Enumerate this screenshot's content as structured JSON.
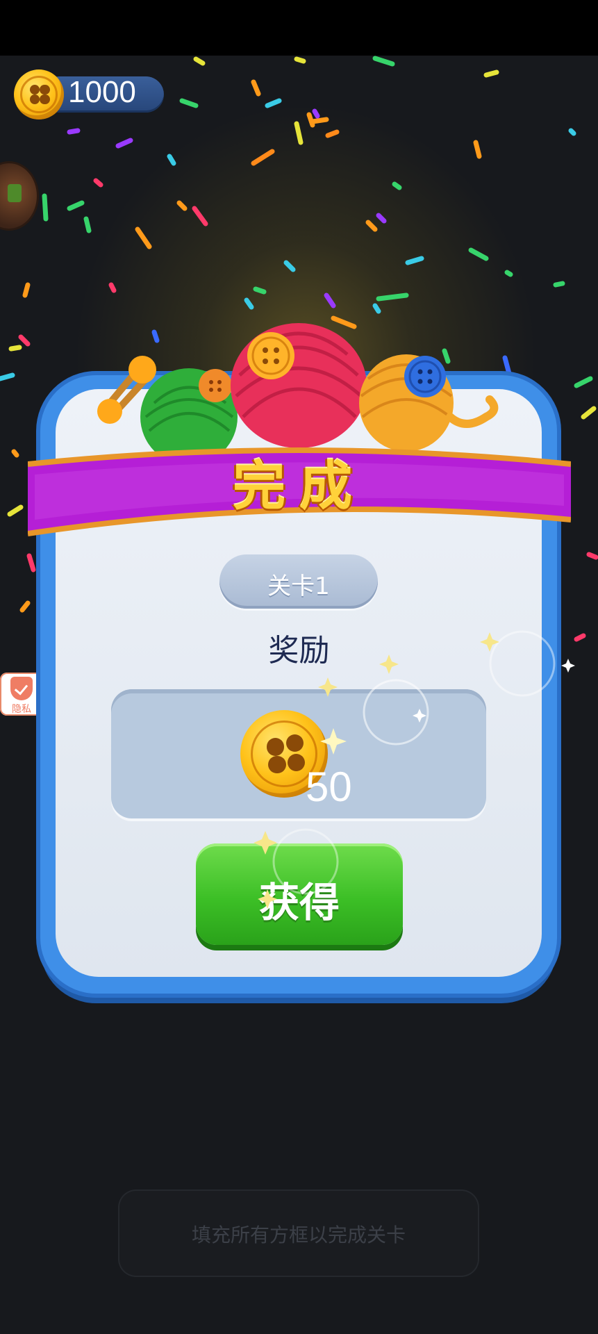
{
  "hud": {
    "coin_count": "1000"
  },
  "dialog": {
    "title": "完成",
    "level_label": "关卡1",
    "reward_title": "奖励",
    "reward_amount": "50",
    "claim_label": "获得"
  },
  "privacy": {
    "label": "隐私"
  },
  "hint": {
    "text": "填充所有方框以完成关卡"
  },
  "colors": {
    "panel_frame": "#3f8fe8",
    "banner": "#b51fd6",
    "title_gold": "#ffd23a",
    "button_green": "#3cbf26",
    "reward_box": "#b7c9de"
  }
}
